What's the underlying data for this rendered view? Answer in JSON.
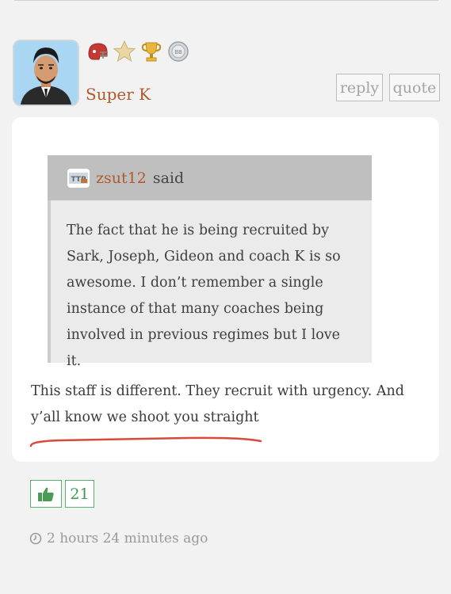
{
  "post": {
    "author": "Super K",
    "reply_label": "reply",
    "quote_label": "quote",
    "badges": [
      "football-helmet-icon",
      "star-icon",
      "trophy-icon",
      "silver-medal-icon"
    ],
    "quote": {
      "author": "zsut12",
      "said_label": "said",
      "text": "The fact that he is being recruited by Sark, Joseph, Gideon and coach K is so awesome. I don’t remember a single instance of that many coaches being involved in previous regimes but I love it."
    },
    "body": "This staff is different. They recruit with urgency. And y’all know we shoot you straight",
    "likes": "21",
    "timestamp": "2 hours 24 minutes ago"
  },
  "colors": {
    "author": "#b05a2a",
    "like_green": "#5db06b",
    "underline_red": "#d9493a"
  }
}
